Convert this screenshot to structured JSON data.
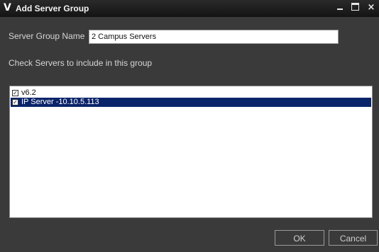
{
  "window": {
    "title": "Add Server Group",
    "logo": "V",
    "controls": {
      "minimize_icon": "minimize-icon",
      "maximize_icon": "maximize-icon",
      "close_icon": "close-icon",
      "close_glyph": "×"
    }
  },
  "form": {
    "group_name_label": "Server Group Name",
    "group_name_value": "2 Campus Servers",
    "check_label": "Check Servers to include in this group"
  },
  "servers": [
    {
      "name": "v6.2",
      "checked": true,
      "check_glyph": "✓",
      "selected": false
    },
    {
      "name": "IP Server -10.10.5.113",
      "checked": true,
      "check_glyph": "✓",
      "selected": true
    }
  ],
  "buttons": {
    "ok": "OK",
    "cancel": "Cancel"
  },
  "colors": {
    "selection": "#0a246a",
    "background": "#3a3a3a",
    "titlebar": "#1e1e1e"
  }
}
